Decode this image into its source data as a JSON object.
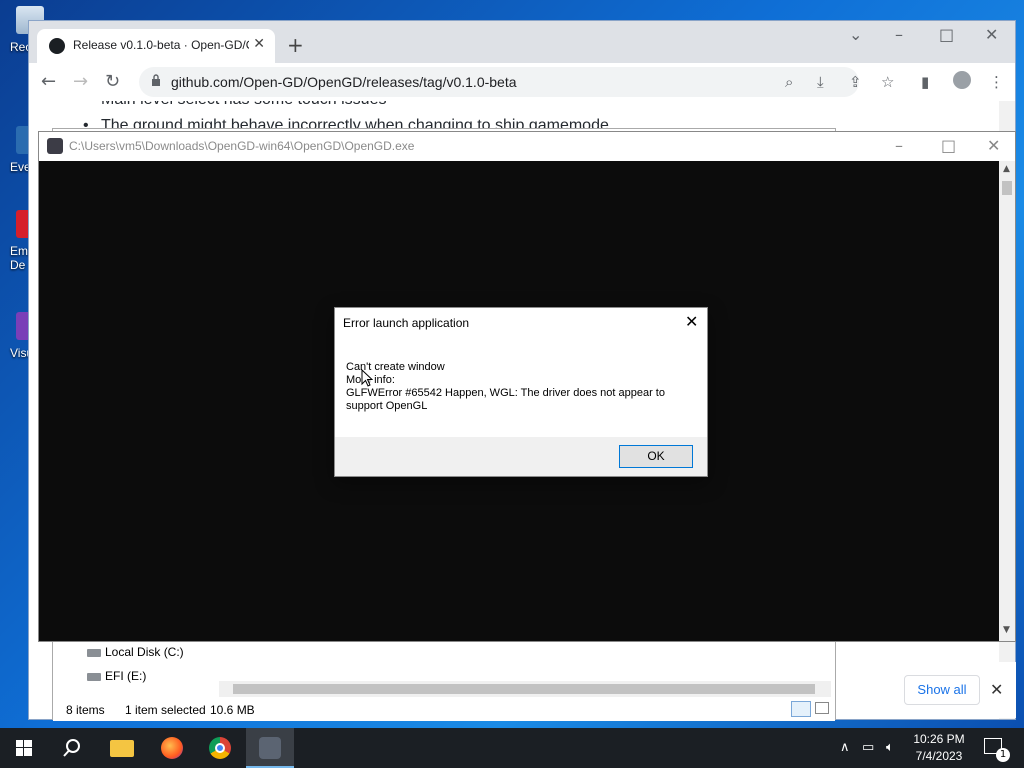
{
  "desktop": {
    "icons": [
      {
        "label": "Rec"
      },
      {
        "label": "Eve"
      },
      {
        "label": "Emb\nDe"
      },
      {
        "label": "Visu"
      }
    ]
  },
  "browser": {
    "tab_title": "Release v0.1.0-beta · Open-GD/OpenGD",
    "url": "github.com/Open-GD/OpenGD/releases/tag/v0.1.0-beta",
    "page_lines": [
      "Main level select has some touch issues",
      "The ground might behave incorrectly when changing to ship gamemode"
    ]
  },
  "explorer": {
    "tree": [
      "Local Disk (C:)",
      "EFI (E:)"
    ],
    "status": {
      "items": "8 items",
      "selected": "1 item selected",
      "size": "10.6 MB"
    }
  },
  "downloads": {
    "show_all": "Show all"
  },
  "console_window": {
    "title": "C:\\Users\\vm5\\Downloads\\OpenGD-win64\\OpenGD\\OpenGD.exe"
  },
  "dialog": {
    "title": "Error launch application",
    "lines": [
      "Can't create window",
      "More info:",
      "GLFWError #65542 Happen, WGL: The driver does not appear to",
      "support OpenGL"
    ],
    "ok_label": "OK"
  },
  "taskbar": {
    "time": "10:26 PM",
    "date": "7/4/2023",
    "notification_count": "1",
    "apps": [
      "start-icon",
      "search-icon",
      "file-explorer-icon",
      "firefox-icon",
      "chrome-icon",
      "opengd-icon"
    ]
  },
  "colors": {
    "accent": "#0078d7",
    "taskbar": "#1b1f24",
    "console_bg": "#0c0c0c"
  }
}
